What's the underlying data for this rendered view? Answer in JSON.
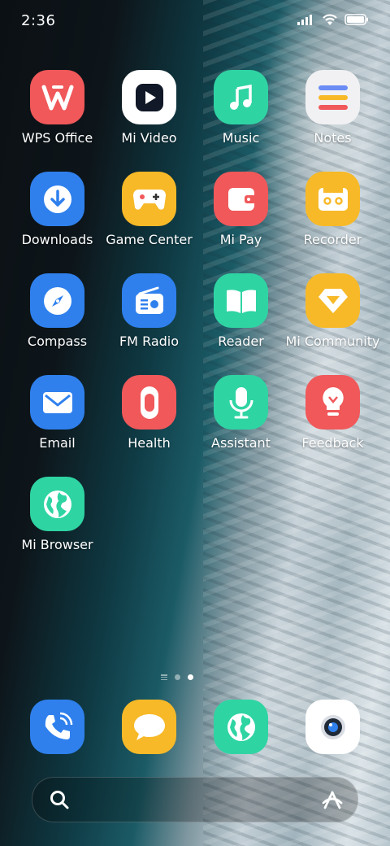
{
  "status_bar": {
    "time": "2:36"
  },
  "apps": [
    {
      "label": "WPS Office",
      "icon": "wps-office-icon",
      "color": "#f0585a"
    },
    {
      "label": "Mi Video",
      "icon": "play-video-icon",
      "color": "#ffffff"
    },
    {
      "label": "Music",
      "icon": "music-note-icon",
      "color": "#2fd4a3"
    },
    {
      "label": "Notes",
      "icon": "notes-list-icon",
      "color": "#f1f1f3"
    },
    {
      "label": "Downloads",
      "icon": "download-arrow-icon",
      "color": "#2f80ed"
    },
    {
      "label": "Game Center",
      "icon": "gamepad-icon",
      "color": "#f7b928"
    },
    {
      "label": "Mi Pay",
      "icon": "wallet-icon",
      "color": "#f0585a"
    },
    {
      "label": "Recorder",
      "icon": "cassette-icon",
      "color": "#f7b928"
    },
    {
      "label": "Compass",
      "icon": "compass-icon",
      "color": "#2f80ed"
    },
    {
      "label": "FM Radio",
      "icon": "radio-icon",
      "color": "#2f80ed"
    },
    {
      "label": "Reader",
      "icon": "open-book-icon",
      "color": "#2fd4a3"
    },
    {
      "label": "Mi Community",
      "icon": "diamond-icon",
      "color": "#f7b928"
    },
    {
      "label": "Email",
      "icon": "envelope-icon",
      "color": "#2f80ed"
    },
    {
      "label": "Health",
      "icon": "fitness-band-icon",
      "color": "#f0585a"
    },
    {
      "label": "Assistant",
      "icon": "microphone-icon",
      "color": "#2fd4a3"
    },
    {
      "label": "Feedback",
      "icon": "lightbulb-icon",
      "color": "#f0585a"
    },
    {
      "label": "Mi Browser",
      "icon": "globe-icon",
      "color": "#2fd4a3"
    }
  ],
  "dock": [
    {
      "icon": "phone-icon",
      "color": "#2f80ed"
    },
    {
      "icon": "message-bubble-icon",
      "color": "#f7b928"
    },
    {
      "icon": "globe-icon",
      "color": "#2fd4a3"
    },
    {
      "icon": "camera-icon",
      "color": "#ffffff"
    }
  ],
  "pages": {
    "count": 2,
    "current": 2
  }
}
